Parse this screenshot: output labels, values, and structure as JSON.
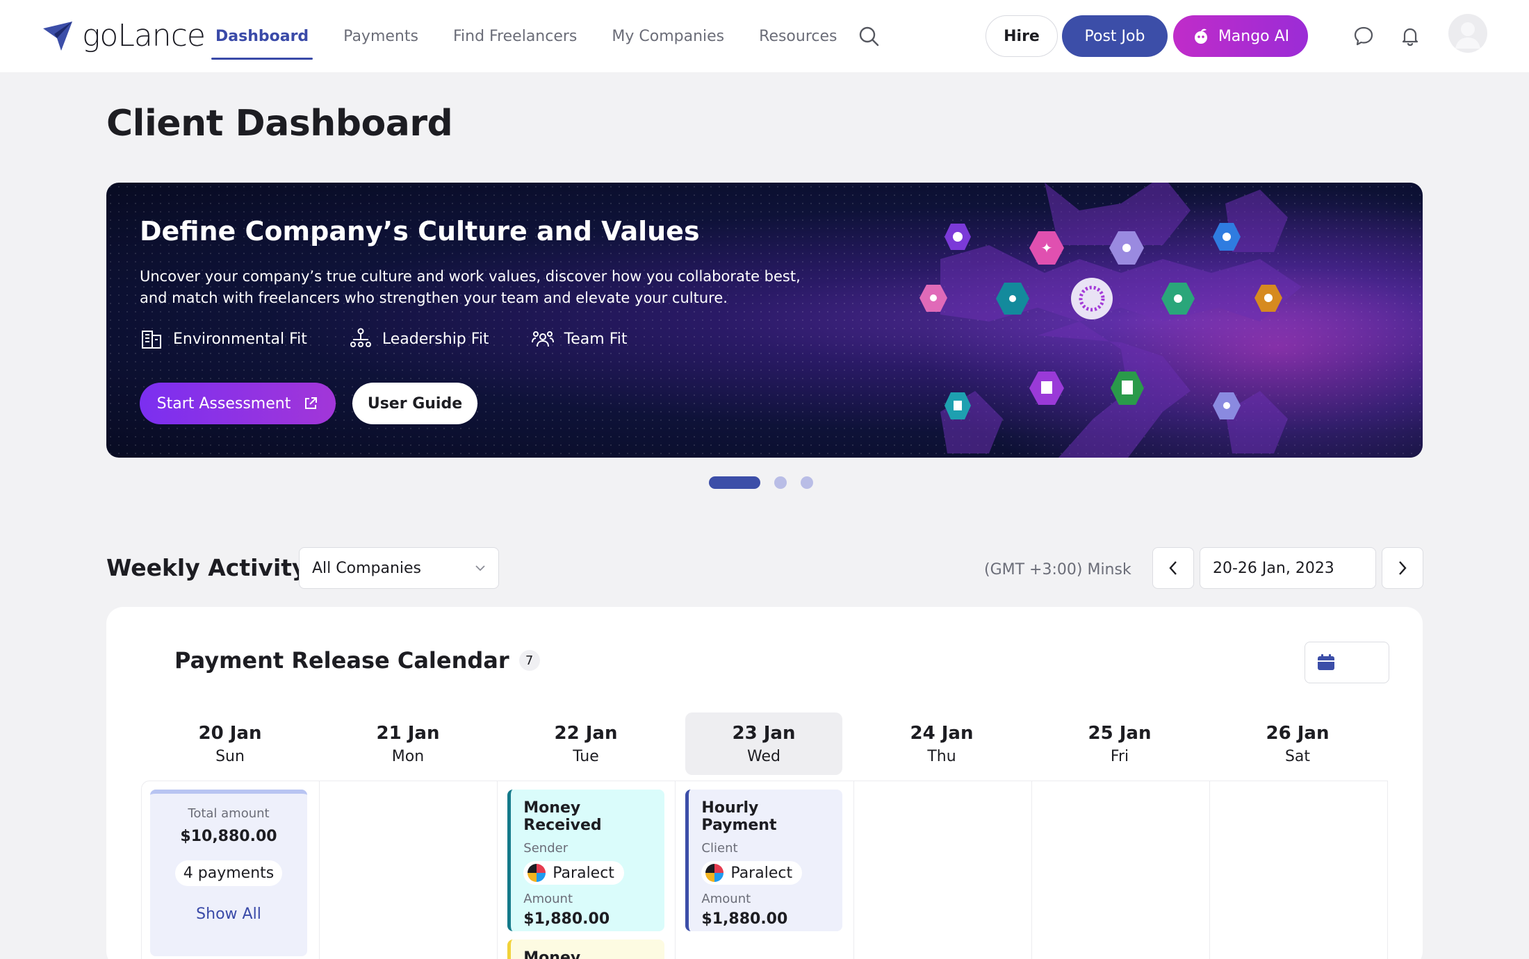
{
  "brand": {
    "name": "goLance"
  },
  "nav": {
    "items": [
      {
        "label": "Dashboard",
        "active": true
      },
      {
        "label": "Payments"
      },
      {
        "label": "Find Freelancers"
      },
      {
        "label": "My Companies"
      },
      {
        "label": "Resources"
      }
    ]
  },
  "actions": {
    "hire": "Hire",
    "post_job": "Post Job",
    "mango_ai": "Mango AI"
  },
  "page": {
    "title": "Client Dashboard"
  },
  "banner": {
    "title": "Define Company’s Culture and Values",
    "description": "Uncover your company’s true culture and work values, discover how you collaborate best, and match with freelancers who strengthen your team and elevate your culture.",
    "fits": [
      {
        "label": "Environmental Fit",
        "icon": "building-icon"
      },
      {
        "label": "Leadership Fit",
        "icon": "hierarchy-icon"
      },
      {
        "label": "Team Fit",
        "icon": "team-icon"
      }
    ],
    "start_button": "Start Assessment",
    "guide_button": "User Guide"
  },
  "weekly": {
    "title": "Weekly Activity",
    "company_select": "All Companies",
    "timezone": "(GMT +3:00) Minsk",
    "date_range": "20-26 Jan, 2023"
  },
  "calendar": {
    "title": "Payment Release Calendar",
    "count": "7",
    "days": [
      {
        "date": "20 Jan",
        "day": "Sun"
      },
      {
        "date": "21 Jan",
        "day": "Mon"
      },
      {
        "date": "22 Jan",
        "day": "Tue"
      },
      {
        "date": "23 Jan",
        "day": "Wed"
      },
      {
        "date": "24 Jan",
        "day": "Thu"
      },
      {
        "date": "25 Jan",
        "day": "Fri"
      },
      {
        "date": "26 Jan",
        "day": "Sat"
      }
    ],
    "summary": {
      "label": "Total amount",
      "amount": "$10,880.00",
      "count": "4 payments",
      "show_all": "Show All"
    },
    "cards": [
      {
        "title": "Money Received",
        "party_label": "Sender",
        "party": "Paralect",
        "amount_label": "Amount",
        "amount": "$1,880.00"
      },
      {
        "title": "Hourly Payment",
        "party_label": "Client",
        "party": "Paralect",
        "amount_label": "Amount",
        "amount": "$1,880.00"
      }
    ],
    "partial_card": "Money Received"
  },
  "colors": {
    "primary": "#3c4ea8",
    "mango": "#c02cc9",
    "banner_bg": "#0e1238"
  }
}
